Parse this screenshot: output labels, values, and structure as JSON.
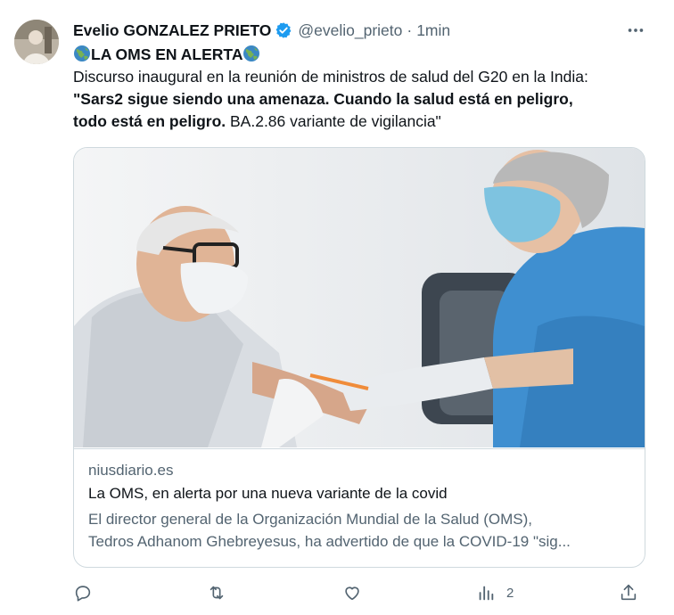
{
  "author": {
    "name": "Evelio GONZALEZ PRIETO",
    "handle": "@evelio_prieto",
    "separator": "·",
    "time": "1min"
  },
  "tweet": {
    "heading": "LA OMS EN ALERTA",
    "line1": "Discurso inaugural en la reunión de ministros de salud del G20 en la India:",
    "bold1": "\"Sars2 sigue siendo una amenaza. Cuando la salud está en peligro,",
    "bold2": "todo está en peligro.",
    "tail": " BA.2.86 variante de vigilancia\""
  },
  "card": {
    "domain": "niusdiario.es",
    "title": "La OMS, en alerta por una nueva variante de la covid",
    "desc1": "El director general de la Organización Mundial de la Salud (OMS),",
    "desc2": "Tedros Adhanom Ghebreyesus, ha advertido de que la COVID-19 \"sig..."
  },
  "actions": {
    "views_count": "2"
  },
  "icons": {
    "more": "more-icon",
    "verified": "verified-badge-icon",
    "globe": "globe-emoji-icon",
    "reply": "reply-icon",
    "repost": "repost-icon",
    "like": "like-icon",
    "views": "views-icon",
    "share": "share-icon"
  },
  "colors": {
    "text": "#0f1419",
    "secondary": "#536471",
    "verified": "#1d9bf0",
    "border": "#cfd9de"
  }
}
